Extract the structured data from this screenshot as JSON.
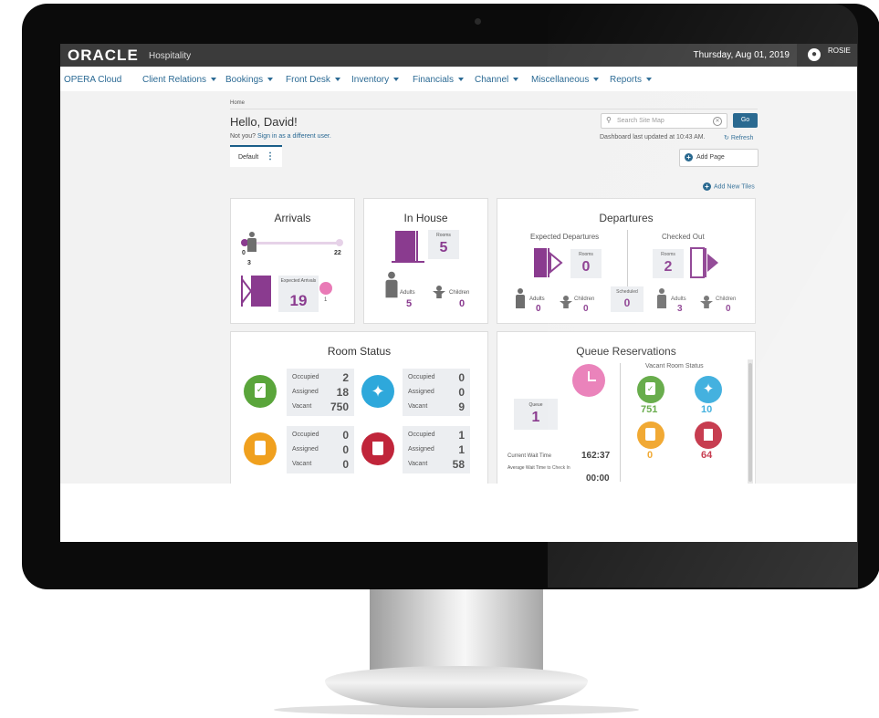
{
  "topbar": {
    "brand": "ORACLE",
    "brand_sub": "Hospitality",
    "date": "Thursday, Aug 01, 2019",
    "user": "ROSIE"
  },
  "nav": {
    "home": "OPERA Cloud",
    "items": [
      "Client Relations",
      "Bookings",
      "Front Desk",
      "Inventory",
      "Financials",
      "Channel",
      "Miscellaneous",
      "Reports"
    ]
  },
  "page": {
    "breadcrumb": "Home",
    "greeting": "Hello, David!",
    "not_you": "Not you?",
    "sign_in_link": "Sign in as a different user.",
    "search_placeholder": "Search Site Map",
    "go": "Go",
    "last_updated": "Dashboard last updated at 10:43 AM.",
    "refresh": "Refresh",
    "tab_default": "Default",
    "add_page": "Add Page",
    "add_tiles": "Add New Tiles"
  },
  "arrivals": {
    "title": "Arrivals",
    "progress_fraction": 0.136,
    "range_min": "0",
    "range_max": "22",
    "arrived": "3",
    "expected_label": "Expected Arrivals",
    "expected": "19",
    "late": "1"
  },
  "in_house": {
    "title": "In House",
    "rooms_label": "Rooms",
    "rooms": "5",
    "adults_label": "Adults",
    "adults": "5",
    "children_label": "Children",
    "children": "0"
  },
  "departures": {
    "title": "Departures",
    "expected_title": "Expected Departures",
    "expected_rooms_label": "Rooms",
    "expected_rooms": "0",
    "expected_adults_label": "Adults",
    "expected_adults": "0",
    "expected_children_label": "Children",
    "expected_children": "0",
    "scheduled_label": "Scheduled",
    "scheduled": "0",
    "checked_out_title": "Checked Out",
    "checked_out_rooms_label": "Rooms",
    "checked_out_rooms": "2",
    "checked_out_adults_label": "Adults",
    "checked_out_adults": "3",
    "checked_out_children_label": "Children",
    "checked_out_children": "0"
  },
  "room_status": {
    "title": "Room Status",
    "labels": {
      "occupied": "Occupied",
      "assigned": "Assigned",
      "vacant": "Vacant"
    },
    "clean": {
      "occupied": "2",
      "assigned": "18",
      "vacant": "750"
    },
    "inspected": {
      "occupied": "0",
      "assigned": "0",
      "vacant": "9"
    },
    "pickup": {
      "occupied": "0",
      "assigned": "0",
      "vacant": "0"
    },
    "dirty": {
      "occupied": "1",
      "assigned": "1",
      "vacant": "58"
    }
  },
  "queue": {
    "title": "Queue Reservations",
    "queue_label": "Queue",
    "queue_count": "1",
    "current_wait_label": "Current Wait Time",
    "current_wait": "162:37",
    "avg_wait_label": "Average Wait Time to Check In",
    "avg_wait": "00:00",
    "vacant_title": "Vacant Room Status",
    "vacant_clean": "751",
    "vacant_inspected": "10",
    "vacant_pickup": "0",
    "vacant_dirty": "64"
  },
  "colors": {
    "purple": "#8a3b8f",
    "green": "#5aa53b",
    "blue": "#2ea8db",
    "orange": "#f0a01e",
    "red": "#c0253a",
    "pink": "#e97ab6",
    "brand_blue": "#1a5e88"
  }
}
